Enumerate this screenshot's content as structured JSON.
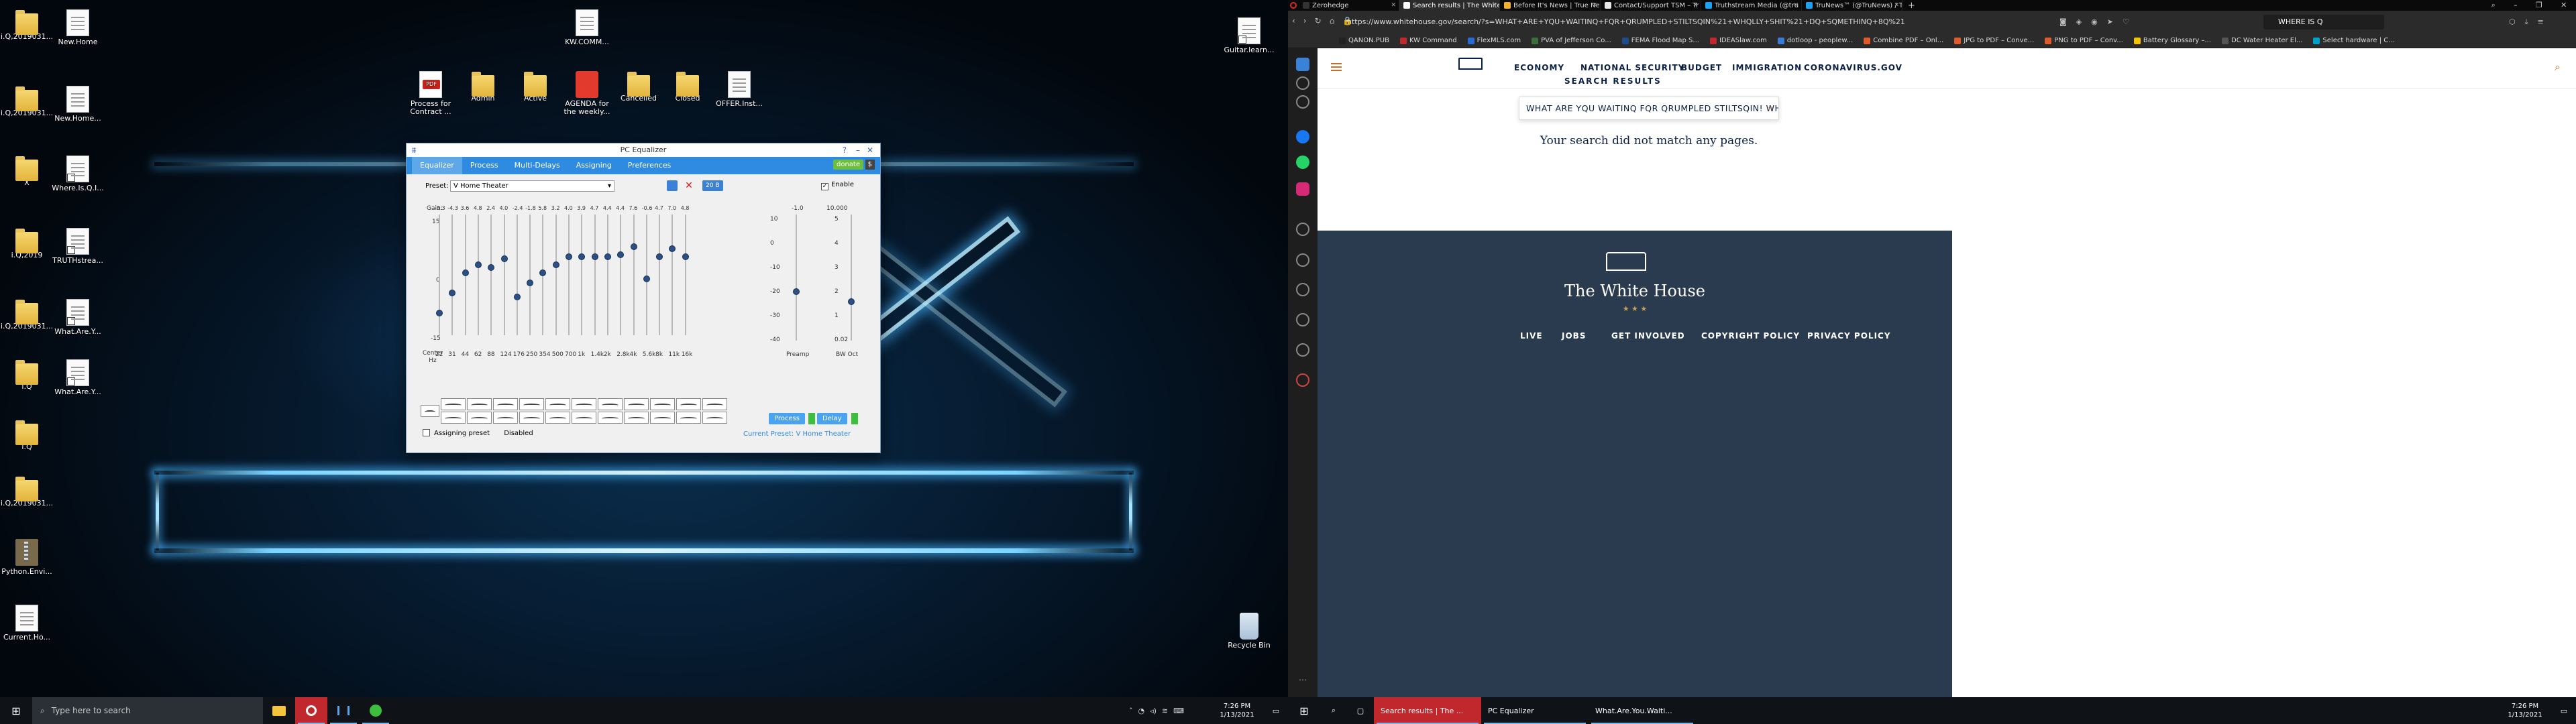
{
  "left_desktop": {
    "icons": [
      {
        "label": "i.Q,2019031...",
        "type": "folder"
      },
      {
        "label": "New.Home",
        "type": "doc"
      },
      {
        "label": "i.Q,2019031...",
        "type": "folder"
      },
      {
        "label": "New.Home...",
        "type": "doc"
      },
      {
        "label": "X",
        "type": "folder"
      },
      {
        "label": "Where.Is.Q.I...",
        "type": "shortcut"
      },
      {
        "label": "i.Q,2019",
        "type": "folder"
      },
      {
        "label": "TRUTHstrea...",
        "type": "shortcut"
      },
      {
        "label": "i.Q,2019031...",
        "type": "folder"
      },
      {
        "label": "What.Are.Y...",
        "type": "shortcut"
      },
      {
        "label": "i.Q",
        "type": "folder"
      },
      {
        "label": "What.Are.Y...",
        "type": "shortcut"
      },
      {
        "label": "i.Q",
        "type": "folder"
      },
      {
        "label": "i.Q,2019031...",
        "type": "folder"
      },
      {
        "label": "Python.Envi...",
        "type": "zip"
      },
      {
        "label": "Current.Ho...",
        "type": "doc"
      },
      {
        "label": "KW.COMM...",
        "type": "doc"
      },
      {
        "label": "Process for Contract ...",
        "type": "pdf"
      },
      {
        "label": "Admin",
        "type": "folder"
      },
      {
        "label": "Active",
        "type": "folder"
      },
      {
        "label": "AGENDA for the weekly...",
        "type": "pdfred"
      },
      {
        "label": "Cancelled",
        "type": "folder"
      },
      {
        "label": "Closed",
        "type": "folder"
      },
      {
        "label": "OFFER.Inst...",
        "type": "doc"
      },
      {
        "label": "Guitar.learn...",
        "type": "shortcut"
      },
      {
        "label": "Recycle Bin",
        "type": "bin"
      }
    ]
  },
  "equalizer": {
    "title": "PC Equalizer",
    "tabs": [
      "Equalizer",
      "Process",
      "Multi-Delays",
      "Assigning",
      "Preferences"
    ],
    "donate": "donate",
    "donate_s": "$",
    "preset_label": "Preset:",
    "preset_value": "V Home Theater",
    "bands_button": "20 B",
    "enable_label": "Enable",
    "gain_label": "Gain:",
    "gain_values": [
      "-3.3",
      "-4.3",
      "3.6",
      "4.8",
      "2.4",
      "4.0",
      "-2.4",
      "-1.8",
      "5.8",
      "3.2",
      "4.0",
      "3.9",
      "4.7",
      "4.4",
      "4.4",
      "7.6",
      "-0.6",
      "4.7",
      "7.0",
      "4.8"
    ],
    "scale_left": [
      "15",
      "0",
      "-15"
    ],
    "center_label": "Center Hz",
    "freqs": [
      "22",
      "31",
      "44",
      "62",
      "88",
      "124",
      "176",
      "250",
      "354",
      "500",
      "700",
      "1k",
      "1.4k",
      "2k",
      "2.8k",
      "4k",
      "5.6k",
      "8k",
      "11k",
      "16k"
    ],
    "band_levels": [
      -9.5,
      -4.5,
      0.5,
      2.5,
      1.8,
      4,
      -5.5,
      -2,
      0.5,
      2.5,
      4.5,
      4.5,
      4.5,
      4.5,
      5,
      7,
      -1,
      4.5,
      6.5,
      4.5
    ],
    "preamp_label": "Preamp",
    "preamp_top": "-1.0",
    "preamp_scale": [
      "10",
      "0",
      "-10",
      "-20",
      "-30",
      "-40"
    ],
    "bwoct_label": "BW Oct",
    "bwoct_top": "10.000",
    "bwoct_scale": [
      "5",
      "4",
      "3",
      "2",
      "1",
      "0.02"
    ],
    "assigning_label": "Assigning preset",
    "assigning_state": "Disabled",
    "process_btn": "Process",
    "delay_btn": "Delay",
    "current_preset": "Current Preset: V Home Theater"
  },
  "taskbar_left": {
    "search_placeholder": "Type here to search",
    "time": "7:26 PM",
    "date": "1/13/2021"
  },
  "browser": {
    "tabs": [
      {
        "label": "Zerohedge",
        "color": "#333"
      },
      {
        "label": "Search results | The White",
        "color": "#fff",
        "selected": true
      },
      {
        "label": "Before It's News | True Ne",
        "color": "#f2b22b"
      },
      {
        "label": "Contact/Support TSM – Tr",
        "color": "#e8e8e8"
      },
      {
        "label": "Truthstream Media (@tru",
        "color": "#1da1f2"
      },
      {
        "label": "TruNews™ (@TruNews) / Tw",
        "color": "#1da1f2"
      }
    ],
    "url": "https://www.whitehouse.gov/search/?s=WHAT+ARE+YQU+WAITINQ+FQR+QRUMPLED+STILTSQIN%21+WHQLLY+SHIT%21+DQ+SQMETHINQ+8Q%21",
    "url_display_domain": "whitehouse.gov",
    "search_box": "WHERE IS Q",
    "bookmarks": [
      {
        "label": "QANON.PUB",
        "color": "#222"
      },
      {
        "label": "KW Command",
        "color": "#c0282d"
      },
      {
        "label": "FlexMLS.com",
        "color": "#2a6bd1"
      },
      {
        "label": "PVA of Jefferson Co...",
        "color": "#3b6e3b"
      },
      {
        "label": "FEMA Flood Map S...",
        "color": "#1e4c8a"
      },
      {
        "label": "IDEASlaw.com",
        "color": "#c0282d"
      },
      {
        "label": "dotloop - peoplew...",
        "color": "#3a7bd5"
      },
      {
        "label": "Combine PDF – Onl...",
        "color": "#e05a2b"
      },
      {
        "label": "JPG to PDF – Conve...",
        "color": "#e05a2b"
      },
      {
        "label": "PNG to PDF – Conv...",
        "color": "#e05a2b"
      },
      {
        "label": "Battery Glossary –...",
        "color": "#f5c400"
      },
      {
        "label": "DC Water Heater El...",
        "color": "#555"
      },
      {
        "label": "Select hardware | C...",
        "color": "#00a1c9"
      }
    ],
    "page": {
      "nav_links": [
        "ECONOMY",
        "NATIONAL SECURITY",
        "BUDGET",
        "IMMIGRATION",
        "CORONAVIRUS.GOV"
      ],
      "results_title": "SEARCH RESULTS",
      "search_value": "WHAT ARE YQU WAITINQ FQR QRUMPLED STILTSQIN! WHQLLY SHIT! DQ SQMETI",
      "no_match": "Your search did not match any pages.",
      "footer_brand": "The White House",
      "footer_stars": "★  ★  ★",
      "footer_links": [
        "LIVE",
        "JOBS",
        "GET INVOLVED",
        "COPYRIGHT POLICY",
        "PRIVACY POLICY"
      ]
    }
  },
  "taskbar_right": {
    "items": [
      "Search results | The ...",
      "PC Equalizer",
      "What.Are.You.Waiti..."
    ],
    "time": "7:26 PM",
    "date": "1/13/2021"
  },
  "colors": {
    "eq_accent": "#2f8be0",
    "eq_knob": "#2d4f82",
    "wh_navy": "#0a1f44",
    "footer_bg": "#2a3a4f",
    "taskbar": "#0f1217"
  }
}
